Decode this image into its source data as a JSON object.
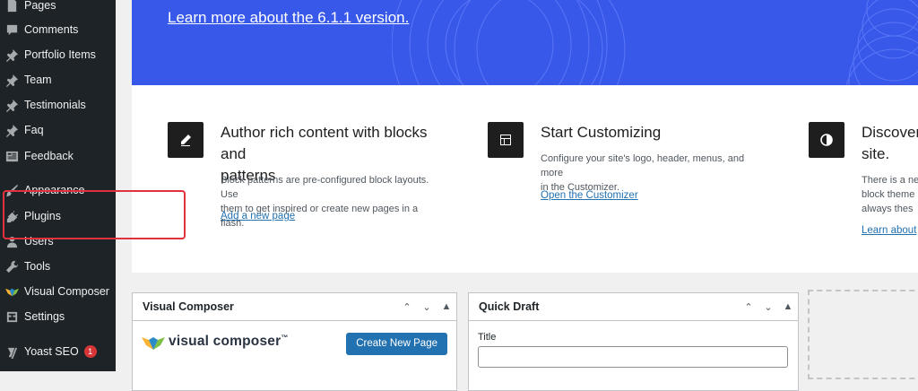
{
  "sidebar": {
    "items": [
      {
        "label": "Pages",
        "icon": "pages-icon",
        "badge": ""
      },
      {
        "label": "Comments",
        "icon": "comments-icon",
        "badge": ""
      },
      {
        "label": "Portfolio Items",
        "icon": "pin-icon",
        "badge": ""
      },
      {
        "label": "Team",
        "icon": "pin-icon",
        "badge": ""
      },
      {
        "label": "Testimonials",
        "icon": "pin-icon",
        "badge": ""
      },
      {
        "label": "Faq",
        "icon": "pin-icon",
        "badge": ""
      },
      {
        "label": "Feedback",
        "icon": "feedback-icon",
        "badge": ""
      },
      {
        "label": "Appearance",
        "icon": "paintbrush-icon",
        "badge": ""
      },
      {
        "label": "Plugins",
        "icon": "plugin-icon",
        "badge": ""
      },
      {
        "label": "Users",
        "icon": "users-icon",
        "badge": ""
      },
      {
        "label": "Tools",
        "icon": "wrench-icon",
        "badge": ""
      },
      {
        "label": "Visual Composer",
        "icon": "visual-composer-icon",
        "badge": ""
      },
      {
        "label": "Settings",
        "icon": "settings-icon",
        "badge": ""
      },
      {
        "label": "Yoast SEO",
        "icon": "yoast-icon",
        "badge": "1"
      }
    ]
  },
  "hero": {
    "link": "Learn more about the 6.1.1 version."
  },
  "welcome": {
    "columns": [
      {
        "icon": "pencil-icon",
        "title_line1": "Author rich content with blocks and",
        "title_line2": "patterns",
        "desc_line1": "Block patterns are pre-configured block layouts. Use",
        "desc_line2": "them to get inspired or create new pages in a flash.",
        "desc_line3": "",
        "link": "Add a new page"
      },
      {
        "icon": "layout-icon",
        "title_line1": "Start Customizing",
        "title_line2": "",
        "desc_line1": "Configure your site's logo, header, menus, and more",
        "desc_line2": "in the Customizer.",
        "desc_line3": "",
        "link": "Open the Customizer"
      },
      {
        "icon": "contrast-icon",
        "title_line1": "Discover",
        "title_line2": "site.",
        "desc_line1": "There is a ne",
        "desc_line2": "block theme",
        "desc_line3": "always thes",
        "link": "Learn about"
      }
    ]
  },
  "visual_composer_box": {
    "title": "Visual Composer",
    "logo_text": "visual composer",
    "logo_tm": "™",
    "button": "Create New Page"
  },
  "quick_draft_box": {
    "title": "Quick Draft",
    "title_label": "Title",
    "title_value": ""
  },
  "colors": {
    "sidebar": "#1d2327",
    "hero": "#3858e9",
    "primary": "#2271b1",
    "highlight": "#e0313c"
  }
}
